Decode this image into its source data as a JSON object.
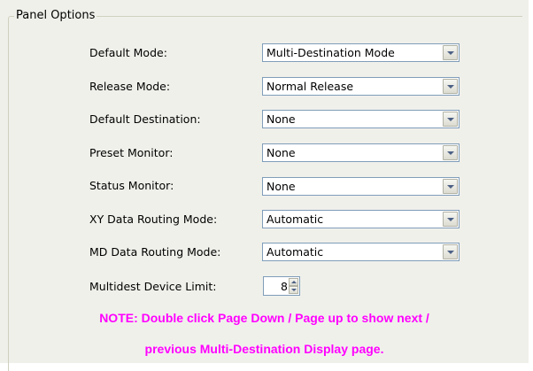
{
  "panel": {
    "title": "Panel Options"
  },
  "fields": {
    "default_mode": {
      "label": "Default Mode:",
      "value": "Multi-Destination Mode"
    },
    "release_mode": {
      "label": "Release Mode:",
      "value": "Normal Release"
    },
    "default_destination": {
      "label": "Default Destination:",
      "value": "None"
    },
    "preset_monitor": {
      "label": "Preset Monitor:",
      "value": "None"
    },
    "status_monitor": {
      "label": "Status Monitor:",
      "value": "None"
    },
    "xy_routing": {
      "label": "XY Data Routing Mode:",
      "value": "Automatic"
    },
    "md_routing": {
      "label": "MD Data Routing Mode:",
      "value": "Automatic"
    },
    "device_limit": {
      "label": "Multidest Device Limit:",
      "value": "8"
    }
  },
  "note": {
    "line1": "NOTE: Double click Page Down / Page up to show next /",
    "line2": "previous Multi-Destination Display page."
  },
  "colors": {
    "background": "#f0f0eb",
    "note_text": "#ff00ff",
    "field_border": "#7f9db9"
  },
  "icons": {
    "dropdown": "chevron-down-icon",
    "spinner_up": "arrow-up-icon",
    "spinner_down": "arrow-down-icon"
  }
}
